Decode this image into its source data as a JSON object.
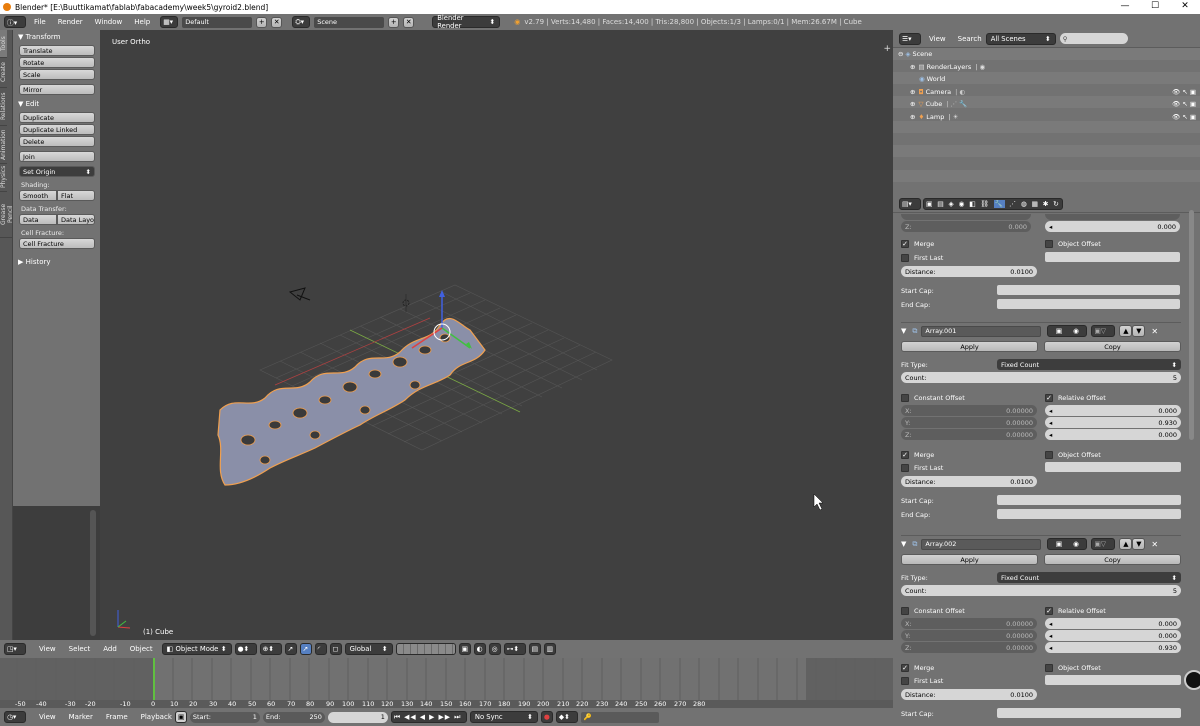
{
  "window": {
    "title": "Blender* [E:\\Buuttikamat\\fablab\\fabacademy\\week5\\gyroid2.blend]",
    "minimize": "—",
    "maximize": "☐",
    "close": "✕"
  },
  "info": {
    "menus": [
      "File",
      "Render",
      "Window",
      "Help"
    ],
    "layout": "Default",
    "scene": "Scene",
    "engine": "Blender Render",
    "stats": "v2.79 | Verts:14,480 | Faces:14,400 | Tris:28,800 | Objects:1/3 | Lamps:0/1 | Mem:26.67M | Cube"
  },
  "toolshelf": {
    "tabs": [
      "Tools",
      "Create",
      "Relations",
      "Animation",
      "Physics",
      "Grease Pencil"
    ],
    "transform_header": "Transform",
    "transform": [
      "Translate",
      "Rotate",
      "Scale"
    ],
    "mirror": "Mirror",
    "edit_header": "Edit",
    "edit": [
      "Duplicate",
      "Duplicate Linked",
      "Delete"
    ],
    "join": "Join",
    "set_origin": "Set Origin",
    "shading_label": "Shading:",
    "smooth": "Smooth",
    "flat": "Flat",
    "data_transfer_label": "Data Transfer:",
    "data": "Data",
    "data_layo": "Data Layo",
    "cell_fracture_label": "Cell Fracture:",
    "cell_fracture": "Cell Fracture",
    "history": "History"
  },
  "viewport": {
    "view_label": "User Ortho",
    "object_label": "(1) Cube"
  },
  "view3d_header": {
    "menus": [
      "View",
      "Select",
      "Add",
      "Object"
    ],
    "mode": "Object Mode",
    "orientation": "Global"
  },
  "timeline": {
    "ticks": [
      "-50",
      "-40",
      "-30",
      "-20",
      "-10",
      "0",
      "10",
      "20",
      "30",
      "40",
      "50",
      "60",
      "70",
      "80",
      "90",
      "100",
      "110",
      "120",
      "130",
      "140",
      "150",
      "160",
      "170",
      "180",
      "190",
      "200",
      "210",
      "220",
      "230",
      "240",
      "250",
      "260",
      "270",
      "280"
    ],
    "current_frame_value": 1
  },
  "timeline_header": {
    "menus": [
      "View",
      "Marker",
      "Frame",
      "Playback"
    ],
    "start_label": "Start:",
    "start": "1",
    "end_label": "End:",
    "end": "250",
    "current": "1",
    "sync": "No Sync"
  },
  "outliner": {
    "view": "View",
    "search": "Search",
    "filter": "All Scenes",
    "items": [
      "Scene",
      "RenderLayers",
      "World",
      "Camera",
      "Cube",
      "Lamp"
    ]
  },
  "properties": {
    "top": {
      "z_label": "Z:",
      "z_left": "0.000",
      "z_right": "0.000",
      "merge": "Merge",
      "first_last": "First Last",
      "object_offset": "Object Offset",
      "distance_label": "Distance:",
      "distance": "0.0100",
      "start_cap": "Start Cap:",
      "end_cap": "End Cap:"
    },
    "modifiers": [
      {
        "name": "Array.001",
        "apply": "Apply",
        "copy": "Copy",
        "fit_type_label": "Fit Type:",
        "fit_type": "Fixed Count",
        "count_label": "Count:",
        "count": "5",
        "constant_offset": "Constant Offset",
        "relative_offset": "Relative Offset",
        "x_label": "X:",
        "y_label": "Y:",
        "z_label": "Z:",
        "const_x": "0.00000",
        "const_y": "0.00000",
        "const_z": "0.00000",
        "rel_x": "0.000",
        "rel_y": "0.930",
        "rel_z": "0.000",
        "merge": "Merge",
        "first_last": "First Last",
        "object_offset": "Object Offset",
        "distance_label": "Distance:",
        "distance": "0.0100",
        "start_cap": "Start Cap:",
        "end_cap": "End Cap:"
      },
      {
        "name": "Array.002",
        "apply": "Apply",
        "copy": "Copy",
        "fit_type_label": "Fit Type:",
        "fit_type": "Fixed Count",
        "count_label": "Count:",
        "count": "5",
        "constant_offset": "Constant Offset",
        "relative_offset": "Relative Offset",
        "x_label": "X:",
        "y_label": "Y:",
        "z_label": "Z:",
        "const_x": "0.00000",
        "const_y": "0.00000",
        "const_z": "0.00000",
        "rel_x": "0.000",
        "rel_y": "0.000",
        "rel_z": "0.930",
        "merge": "Merge",
        "first_last": "First Last",
        "object_offset": "Object Offset",
        "distance_label": "Distance:",
        "distance": "0.0100",
        "start_cap": "Start Cap:"
      }
    ]
  },
  "colors": {
    "accent": "#5680c2",
    "selection_outline": "#f0a050",
    "frame_line": "#60c040"
  }
}
